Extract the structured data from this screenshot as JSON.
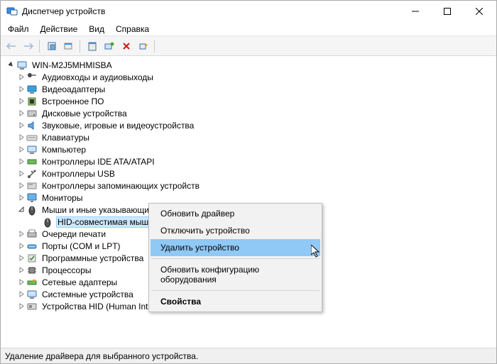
{
  "window": {
    "title": "Диспетчер устройств"
  },
  "menu": {
    "file": "Файл",
    "action": "Действие",
    "view": "Вид",
    "help": "Справка"
  },
  "root": "WIN-M2J5MHMISBA",
  "categories": [
    {
      "id": "audio",
      "label": "Аудиовходы и аудиовыходы"
    },
    {
      "id": "video",
      "label": "Видеоадаптеры"
    },
    {
      "id": "firmware",
      "label": "Встроенное ПО"
    },
    {
      "id": "disk",
      "label": "Дисковые устройства"
    },
    {
      "id": "sound",
      "label": "Звуковые, игровые и видеоустройства"
    },
    {
      "id": "keyboard",
      "label": "Клавиатуры"
    },
    {
      "id": "computer",
      "label": "Компьютер"
    },
    {
      "id": "ide",
      "label": "Контроллеры IDE ATA/ATAPI"
    },
    {
      "id": "usb",
      "label": "Контроллеры USB"
    },
    {
      "id": "storage",
      "label": "Контроллеры запоминающих устройств"
    },
    {
      "id": "monitor",
      "label": "Мониторы"
    },
    {
      "id": "mice",
      "label": "Мыши и иные указывающие устройства",
      "expanded": true,
      "children": [
        {
          "id": "hid-mouse",
          "label": "HID-совместимая мышь",
          "selected": true
        }
      ]
    },
    {
      "id": "printq",
      "label": "Очереди печати"
    },
    {
      "id": "ports",
      "label": "Порты (COM и LPT)"
    },
    {
      "id": "software",
      "label": "Программные устройства"
    },
    {
      "id": "cpu",
      "label": "Процессоры"
    },
    {
      "id": "network",
      "label": "Сетевые адаптеры"
    },
    {
      "id": "system",
      "label": "Системные устройства"
    },
    {
      "id": "hid",
      "label": "Устройства HID (Human Interface Devices)"
    }
  ],
  "context_menu": {
    "update": "Обновить драйвер",
    "disable": "Отключить устройство",
    "remove": "Удалить устройство",
    "rescan": "Обновить конфигурацию оборудования",
    "props": "Свойства"
  },
  "status": "Удаление драйвера для выбранного устройства."
}
